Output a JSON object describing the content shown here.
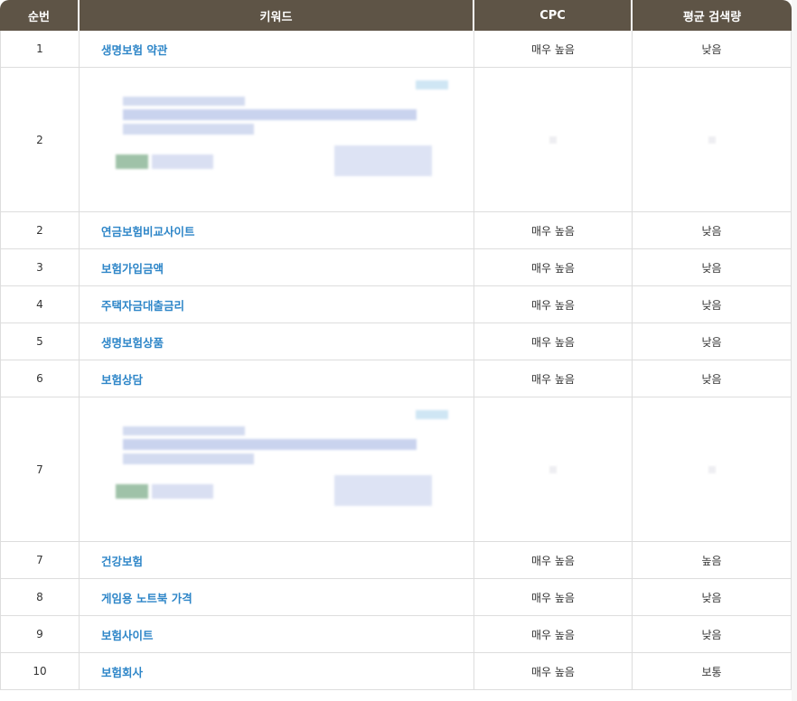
{
  "headers": {
    "rank": "순번",
    "keyword": "키워드",
    "cpc": "CPC",
    "volume": "평균 검색량"
  },
  "rows": [
    {
      "rank": "1",
      "keyword": "생명보험 약관",
      "cpc": "매우 높음",
      "volume": "낮음"
    },
    {
      "rank": "2",
      "ad": true
    },
    {
      "rank": "2",
      "keyword": "연금보험비교사이트",
      "cpc": "매우 높음",
      "volume": "낮음"
    },
    {
      "rank": "3",
      "keyword": "보험가입금액",
      "cpc": "매우 높음",
      "volume": "낮음"
    },
    {
      "rank": "4",
      "keyword": "주택자금대출금리",
      "cpc": "매우 높음",
      "volume": "낮음"
    },
    {
      "rank": "5",
      "keyword": "생명보험상품",
      "cpc": "매우 높음",
      "volume": "낮음"
    },
    {
      "rank": "6",
      "keyword": "보험상담",
      "cpc": "매우 높음",
      "volume": "낮음"
    },
    {
      "rank": "7",
      "ad": true
    },
    {
      "rank": "7",
      "keyword": "건강보험",
      "cpc": "매우 높음",
      "volume": "높음"
    },
    {
      "rank": "8",
      "keyword": "게임용 노트북 가격",
      "cpc": "매우 높음",
      "volume": "낮음"
    },
    {
      "rank": "9",
      "keyword": "보험사이트",
      "cpc": "매우 높음",
      "volume": "낮음"
    },
    {
      "rank": "10",
      "keyword": "보험회사",
      "cpc": "매우 높음",
      "volume": "보통"
    }
  ],
  "colors": {
    "header_bg": "#5e5446",
    "header_text": "#ffffff",
    "link": "#2e86c8",
    "border": "#dddddd"
  }
}
